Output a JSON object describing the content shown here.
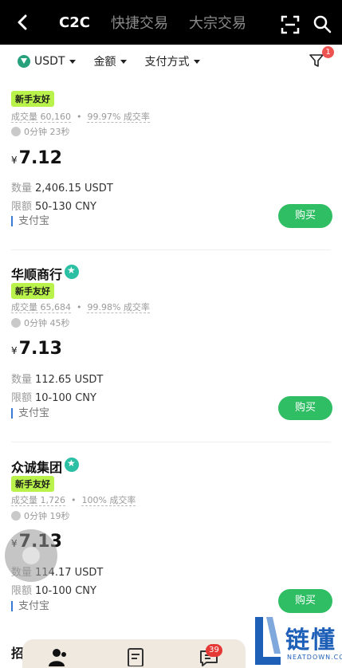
{
  "header": {
    "tabs": [
      {
        "label": "C2C",
        "active": true
      },
      {
        "label": "快捷交易",
        "active": false
      },
      {
        "label": "大宗交易",
        "active": false
      }
    ]
  },
  "filters": {
    "currency": "USDT",
    "amount": "金额",
    "payment": "支付方式",
    "filter_badge": "1"
  },
  "cards": [
    {
      "name": "",
      "tag": "新手友好",
      "volume_label": "成交量",
      "volume": "60,160",
      "rate": "99.97% 成交率",
      "time": "0分钟 23秒",
      "currency_symbol": "¥",
      "price": "7.12",
      "qty_label": "数量",
      "qty": "2,406.15 USDT",
      "limit_label": "限额",
      "limit": "50-130 CNY",
      "pay": "支付宝",
      "buy": "购买"
    },
    {
      "name": "华顺商行",
      "tag": "新手友好",
      "volume_label": "成交量",
      "volume": "65,684",
      "rate": "99.98% 成交率",
      "time": "0分钟 45秒",
      "currency_symbol": "¥",
      "price": "7.13",
      "qty_label": "数量",
      "qty": "112.65 USDT",
      "limit_label": "限额",
      "limit": "10-100 CNY",
      "pay": "支付宝",
      "buy": "购买"
    },
    {
      "name": "众诚集团",
      "tag": "新手友好",
      "volume_label": "成交量",
      "volume": "1,726",
      "rate": "100% 成交率",
      "time": "0分钟 19秒",
      "currency_symbol": "¥",
      "price": "7.13",
      "qty_label": "数量",
      "qty": "114.17 USDT",
      "limit_label": "限额",
      "limit": "10-100 CNY",
      "pay": "支付宝",
      "buy": "购买"
    }
  ],
  "next_card_name": "招",
  "bottom_nav": {
    "messages_badge": "39"
  },
  "watermark": {
    "text": "链懂",
    "sub": "NEATDOWN.COM"
  },
  "colors": {
    "buy": "#2fbe63",
    "tag": "#b9f24a",
    "verified": "#2bbfa4",
    "badge": "#ef5350"
  }
}
